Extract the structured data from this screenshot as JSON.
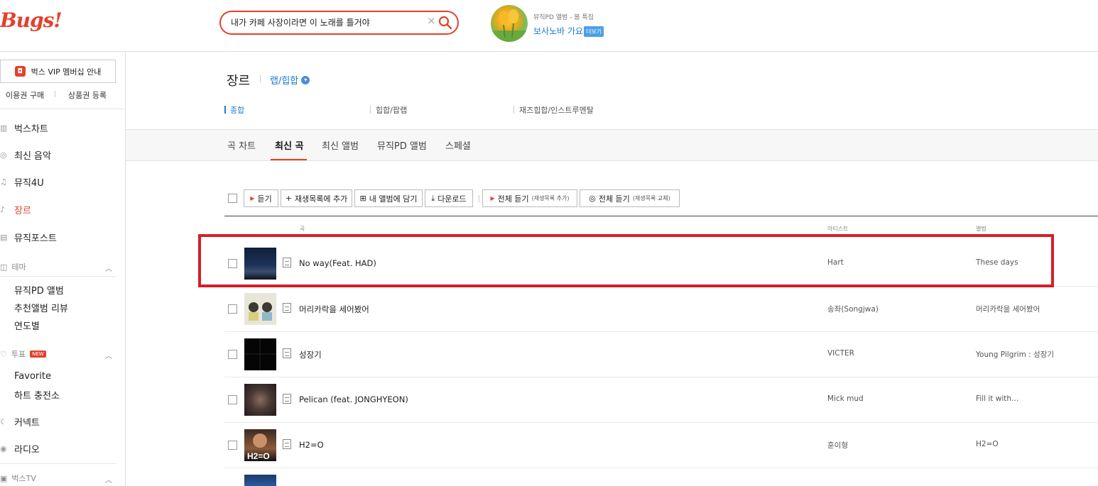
{
  "header": {
    "logo": "Bugs!",
    "search_value": "내가 카페 사장이라면 이 노래를 틀거야",
    "clear_glyph": "×",
    "promo": {
      "subtitle": "뮤직PD 앨범 - 봄 특집",
      "title": "보사노바 가요",
      "more": "더보기"
    }
  },
  "sidebar": {
    "vip_label": "벅스 VIP 멤버십 안내",
    "buy_pass": "이용권 구매",
    "gift_card": "상품권 등록",
    "menu": {
      "chart": "벅스차트",
      "new_music": "최신 음악",
      "music4u": "뮤직4U",
      "genre": "장르",
      "musicpost": "뮤직포스트",
      "theme": "테마",
      "theme_items": [
        "뮤직PD 앨범",
        "추천앨범 리뷰",
        "연도별"
      ],
      "vote": "투표",
      "new_badge": "NEW",
      "vote_items": [
        "Favorite",
        "하트 충전소"
      ],
      "connect": "커넥트",
      "radio": "라디오",
      "bugstv": "벅스TV"
    }
  },
  "main": {
    "genre_title": "장르",
    "genre_selected": "랩/힙합",
    "subgenres": [
      "종합",
      "힙합/팝랩",
      "재즈힙합/인스트루멘탈"
    ],
    "tabs": [
      "곡 차트",
      "최신 곡",
      "최신 앨범",
      "뮤직PD 앨범",
      "스페셜"
    ],
    "toolbar": {
      "listen": "듣기",
      "add_playlist": "재생목록에 추가",
      "add_album": "내 앨범에 담기",
      "download": "다운로드",
      "listen_all_add": "전체 듣기",
      "listen_all_add_note": "(재생목록 추가)",
      "listen_all_replace": "전체 듣기",
      "listen_all_replace_note": "(재생목록 교체)"
    },
    "columns": {
      "song": "곡",
      "artist": "아티스트",
      "album": "앨범"
    },
    "tracks": [
      {
        "title": "No way(Feat. HAD)",
        "artist": "Hart",
        "album": "These days"
      },
      {
        "title": "머리카락을 세어봤어",
        "artist": "송좌(Songjwa)",
        "album": "머리카락을 세어봤어"
      },
      {
        "title": "성장기",
        "artist": "VICTER",
        "album": "Young Pilgrim : 성장기"
      },
      {
        "title": "Pelican (feat. JONGHYEON)",
        "artist": "Mick mud",
        "album": "Fill it with…"
      },
      {
        "title": "H2=O",
        "artist": "훈이형",
        "album": "H2=O"
      }
    ]
  },
  "colors": {
    "brand": "#e2412d",
    "link": "#1e7ad1",
    "highlight": "#d51f27"
  }
}
